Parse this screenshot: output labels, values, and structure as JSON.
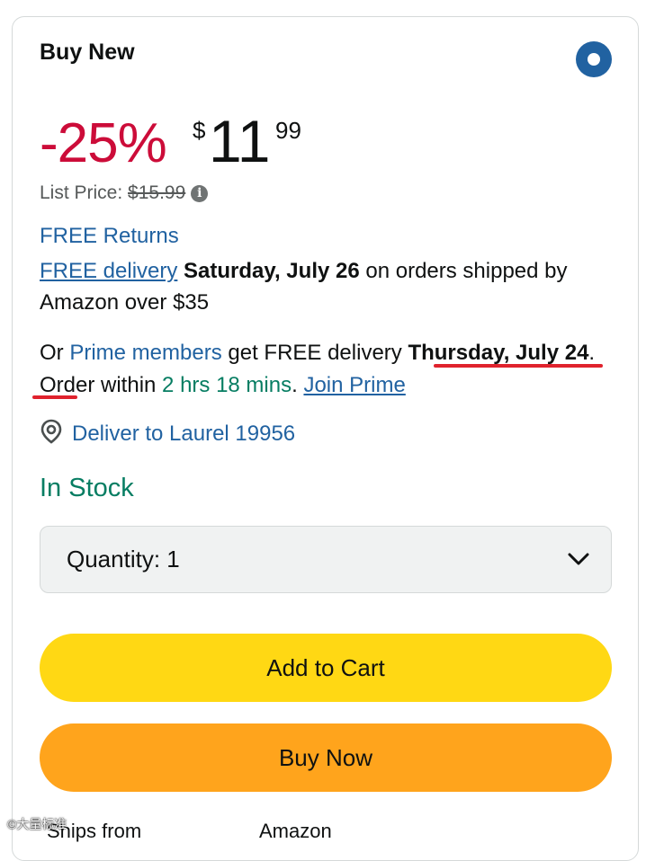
{
  "offer": {
    "title": "Buy New",
    "discount": "-25%",
    "currency_symbol": "$",
    "price_whole": "11",
    "price_fraction": "99",
    "list_price_label": "List Price:",
    "list_price_value": "$15.99",
    "info_icon": "i"
  },
  "shipping": {
    "free_returns": "FREE Returns",
    "free_delivery_link": "FREE delivery",
    "delivery_date": "Saturday, July 26",
    "delivery_suffix": "on orders shipped by Amazon over $35",
    "prime_prefix": "Or",
    "prime_link": "Prime members",
    "prime_mid": "get FREE delivery",
    "prime_date": "Thursday, July 24",
    "order_within_label": ". Order within",
    "countdown": "2 hrs 18 mins",
    "join_prime": "Join Prime",
    "deliver_to": "Deliver to Laurel 19956"
  },
  "stock": {
    "status": "In Stock"
  },
  "quantity": {
    "label": "Quantity:",
    "value": "1"
  },
  "buttons": {
    "add_to_cart": "Add to Cart",
    "buy_now": "Buy Now"
  },
  "ships_from": {
    "label": "Ships from",
    "value": "Amazon"
  },
  "watermark": "©大量标准",
  "colors": {
    "deal_red": "#cc0c39",
    "link_blue": "#2162a1",
    "stock_green": "#067d62",
    "add_to_cart_yellow": "#ffd814",
    "buy_now_orange": "#ffa41c",
    "annotation_red": "#e0222d"
  },
  "icons": {
    "radio": "radio-selected-icon",
    "info": "info-icon",
    "location": "location-pin-icon",
    "dropdown": "chevron-down-icon"
  }
}
